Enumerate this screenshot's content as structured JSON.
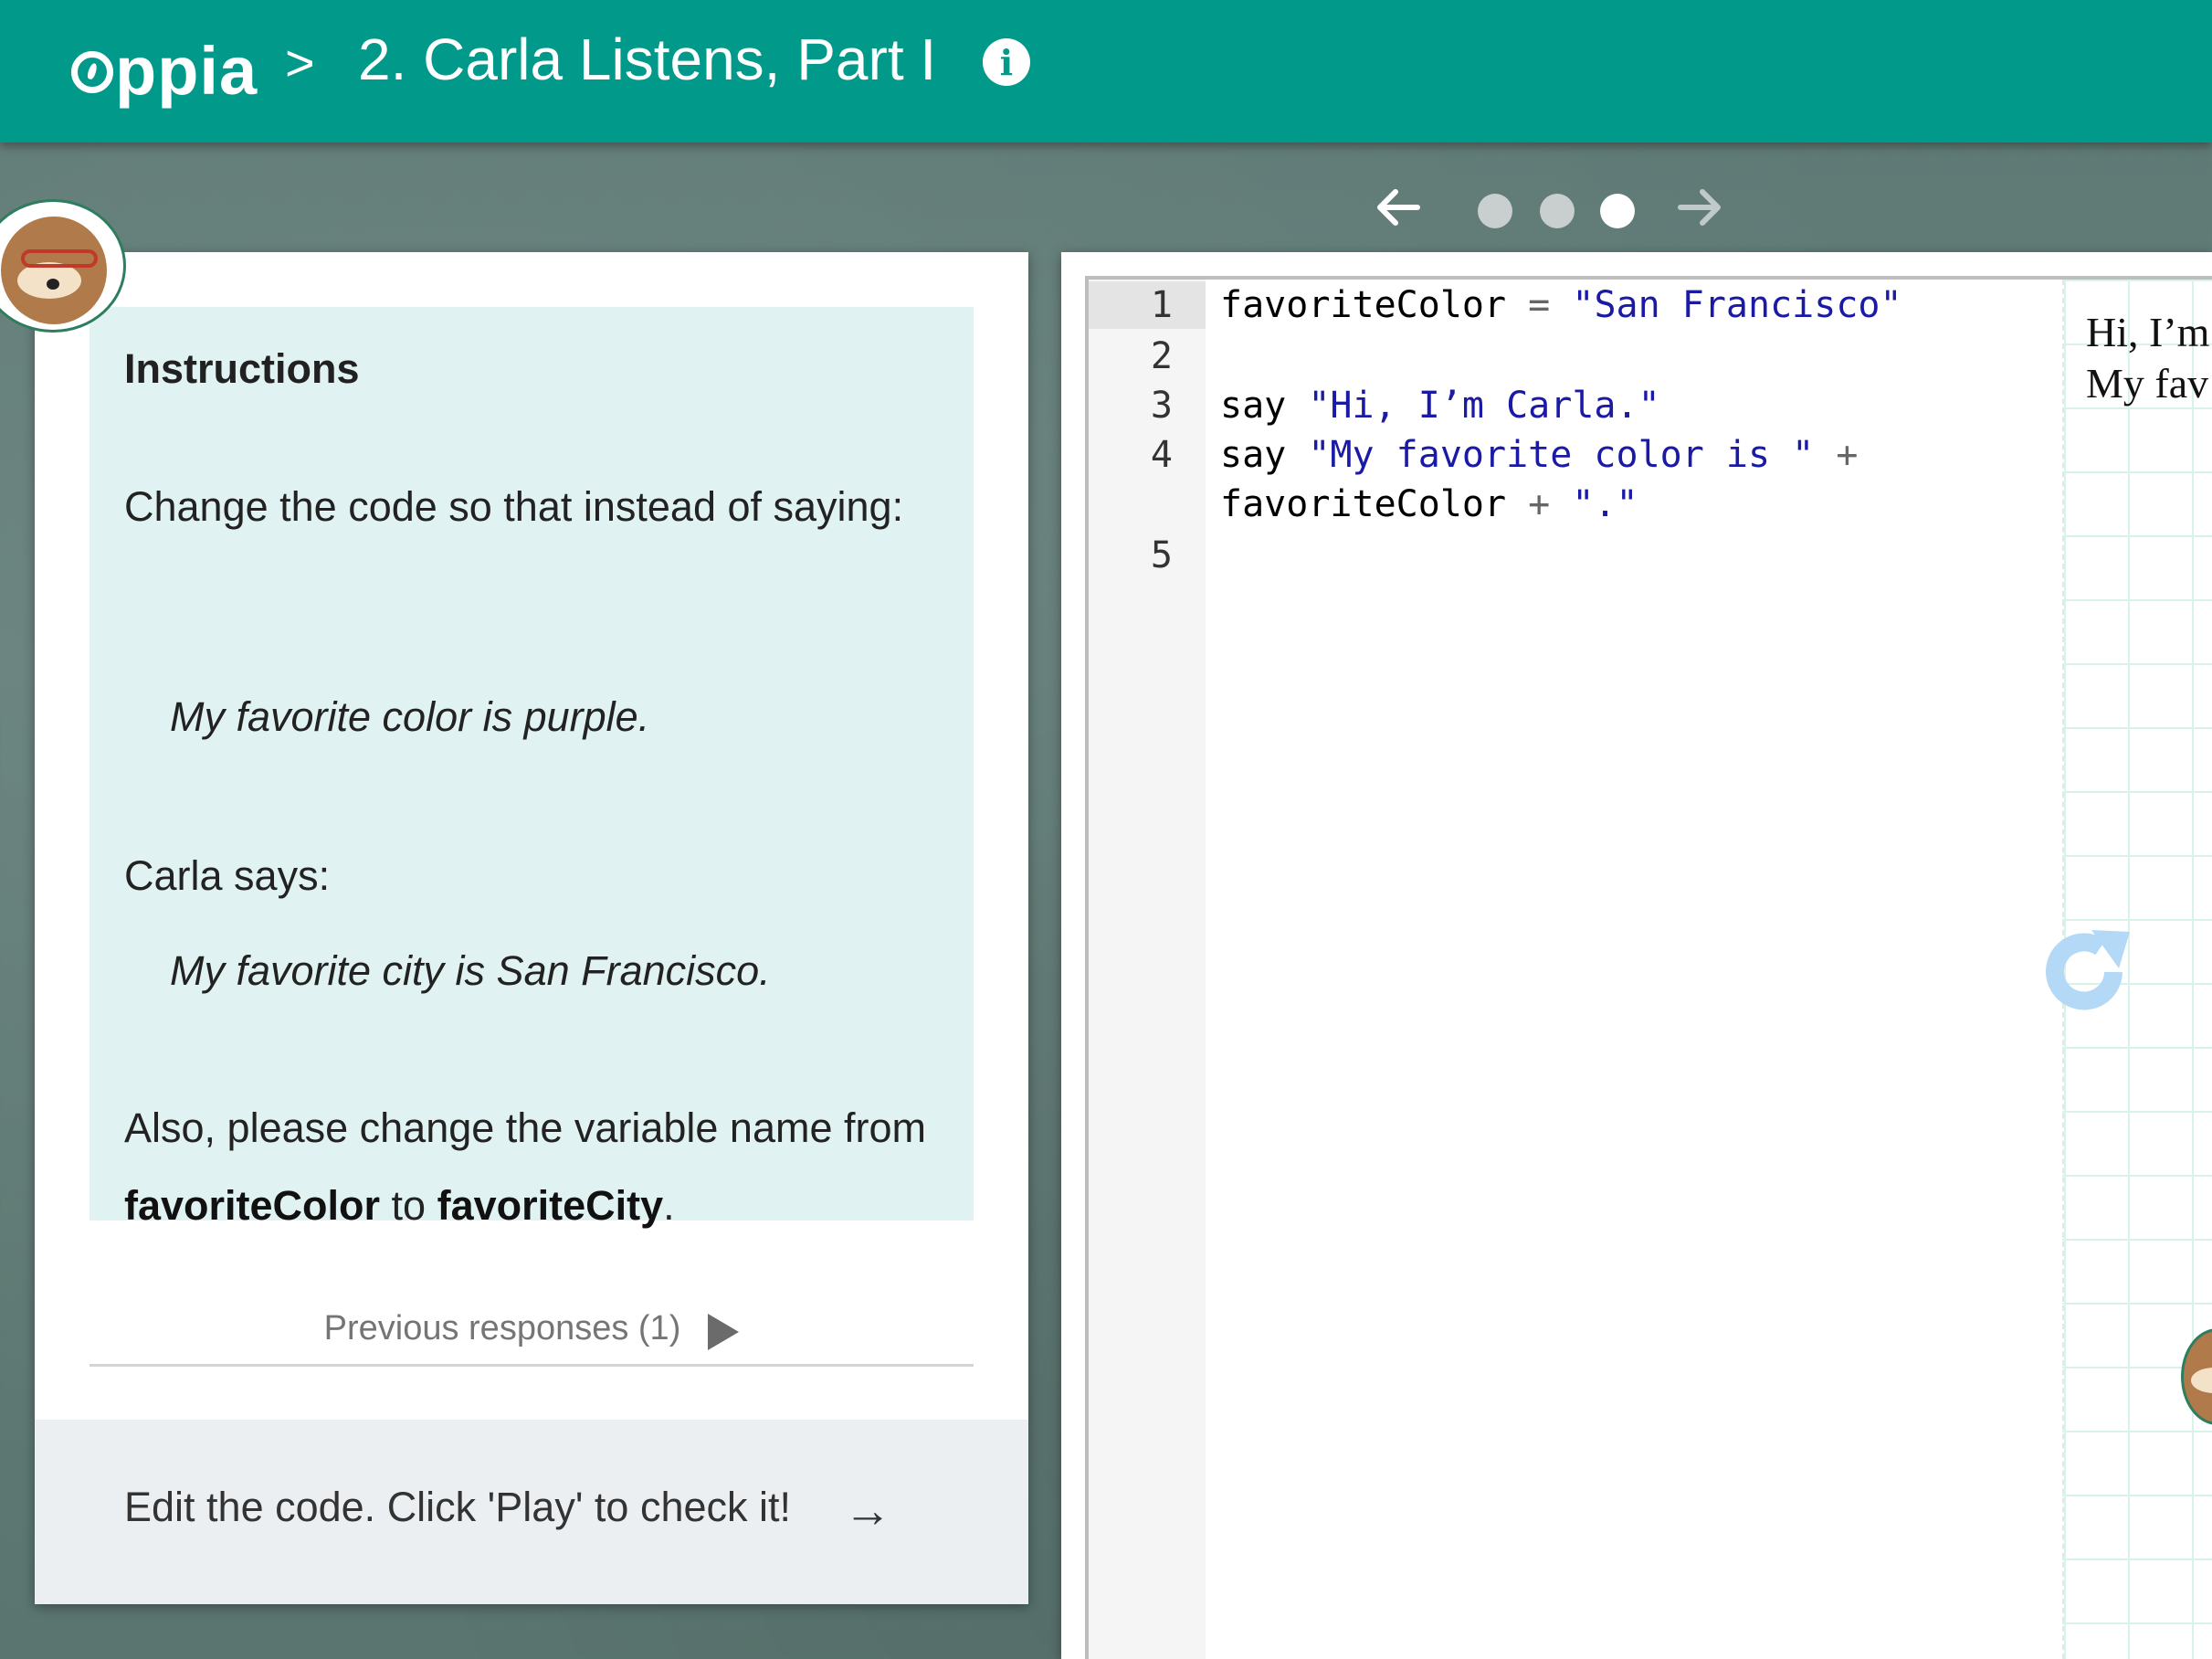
{
  "header": {
    "logo": "ppia",
    "separator": ">",
    "title": "2. Carla Listens, Part I",
    "info_icon": "info-icon"
  },
  "pager": {
    "prev_icon": "arrow-left-icon",
    "next_icon": "arrow-right-icon",
    "pages": 3,
    "current": 3
  },
  "instructions": {
    "title": "Instructions",
    "p1": "Change the code so that instead of saying:",
    "quote1": "My favorite color is purple.",
    "p2": "Carla says:",
    "quote2": "My favorite city is San Francisco.",
    "p3_start": "Also, please change the variable name from ",
    "p3_var1": "favoriteColor",
    "p3_mid": " to ",
    "p3_var2": "favoriteCity",
    "p3_end": "."
  },
  "previous_responses": {
    "label": "Previous responses (1)"
  },
  "footer": {
    "prompt": "Edit the code. Click 'Play' to check it!",
    "arrow": "→"
  },
  "editor": {
    "line_numbers": [
      "1",
      "2",
      "3",
      "4",
      "5"
    ],
    "line1_ident": "favoriteColor",
    "line1_op": "=",
    "line1_str": "\"San Francisco\"",
    "line3_kw": "say",
    "line3_str": "\"Hi, I’m Carla.\"",
    "line4_kw": "say",
    "line4_str": "\"My favorite color is \"",
    "line4_op": "+",
    "line4b_ident": "favoriteColor",
    "line4b_op": "+",
    "line4b_str": "\".\""
  },
  "output": {
    "line1": "Hi, I’m",
    "line2": "My fav"
  },
  "colors": {
    "header": "#00998a",
    "instructions_bg": "#e0f2f1",
    "code_string": "#1a1aa6",
    "reload": "#b3d9f7"
  }
}
